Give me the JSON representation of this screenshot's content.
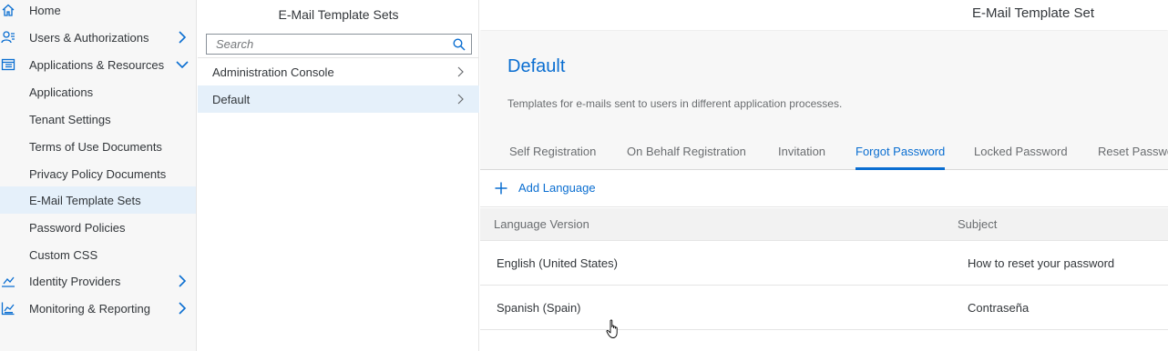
{
  "sidebar": {
    "items": [
      {
        "label": "Home",
        "icon": "home-icon",
        "chevron": ""
      },
      {
        "label": "Users & Authorizations",
        "icon": "users-icon",
        "chevron": "right"
      },
      {
        "label": "Applications & Resources",
        "icon": "applications-icon",
        "chevron": "down"
      },
      {
        "label": "Applications"
      },
      {
        "label": "Tenant Settings"
      },
      {
        "label": "Terms of Use Documents"
      },
      {
        "label": "Privacy Policy Documents"
      },
      {
        "label": "E-Mail Template Sets",
        "selected": true
      },
      {
        "label": "Password Policies"
      },
      {
        "label": "Custom CSS"
      },
      {
        "label": "Identity Providers",
        "icon": "identity-providers-icon",
        "chevron": "right"
      },
      {
        "label": "Monitoring & Reporting",
        "icon": "monitoring-icon",
        "chevron": "right"
      }
    ]
  },
  "master": {
    "title": "E-Mail Template Sets",
    "search_placeholder": "Search",
    "items": [
      {
        "label": "Administration Console"
      },
      {
        "label": "Default",
        "selected": true
      }
    ]
  },
  "detail": {
    "title": "E-Mail Template Set",
    "object_title": "Default",
    "description": "Templates for e-mails sent to users in different application processes.",
    "tabs": [
      {
        "label": "Self Registration"
      },
      {
        "label": "On Behalf Registration"
      },
      {
        "label": "Invitation"
      },
      {
        "label": "Forgot Password",
        "active": true
      },
      {
        "label": "Locked Password"
      },
      {
        "label": "Reset Passwo"
      }
    ],
    "add_language_label": "Add Language",
    "table": {
      "columns": [
        "Language Version",
        "Subject"
      ],
      "rows": [
        {
          "language": "English (United States)",
          "subject": "How to reset your password"
        },
        {
          "language": "Spanish (Spain)",
          "subject": "Contraseña"
        }
      ]
    }
  },
  "colors": {
    "accent": "#0a6ed1",
    "selected_bg": "#e5f0fa",
    "sidebar_bg": "#f7f7f7",
    "text": "#32363a",
    "muted": "#6a6d70"
  }
}
